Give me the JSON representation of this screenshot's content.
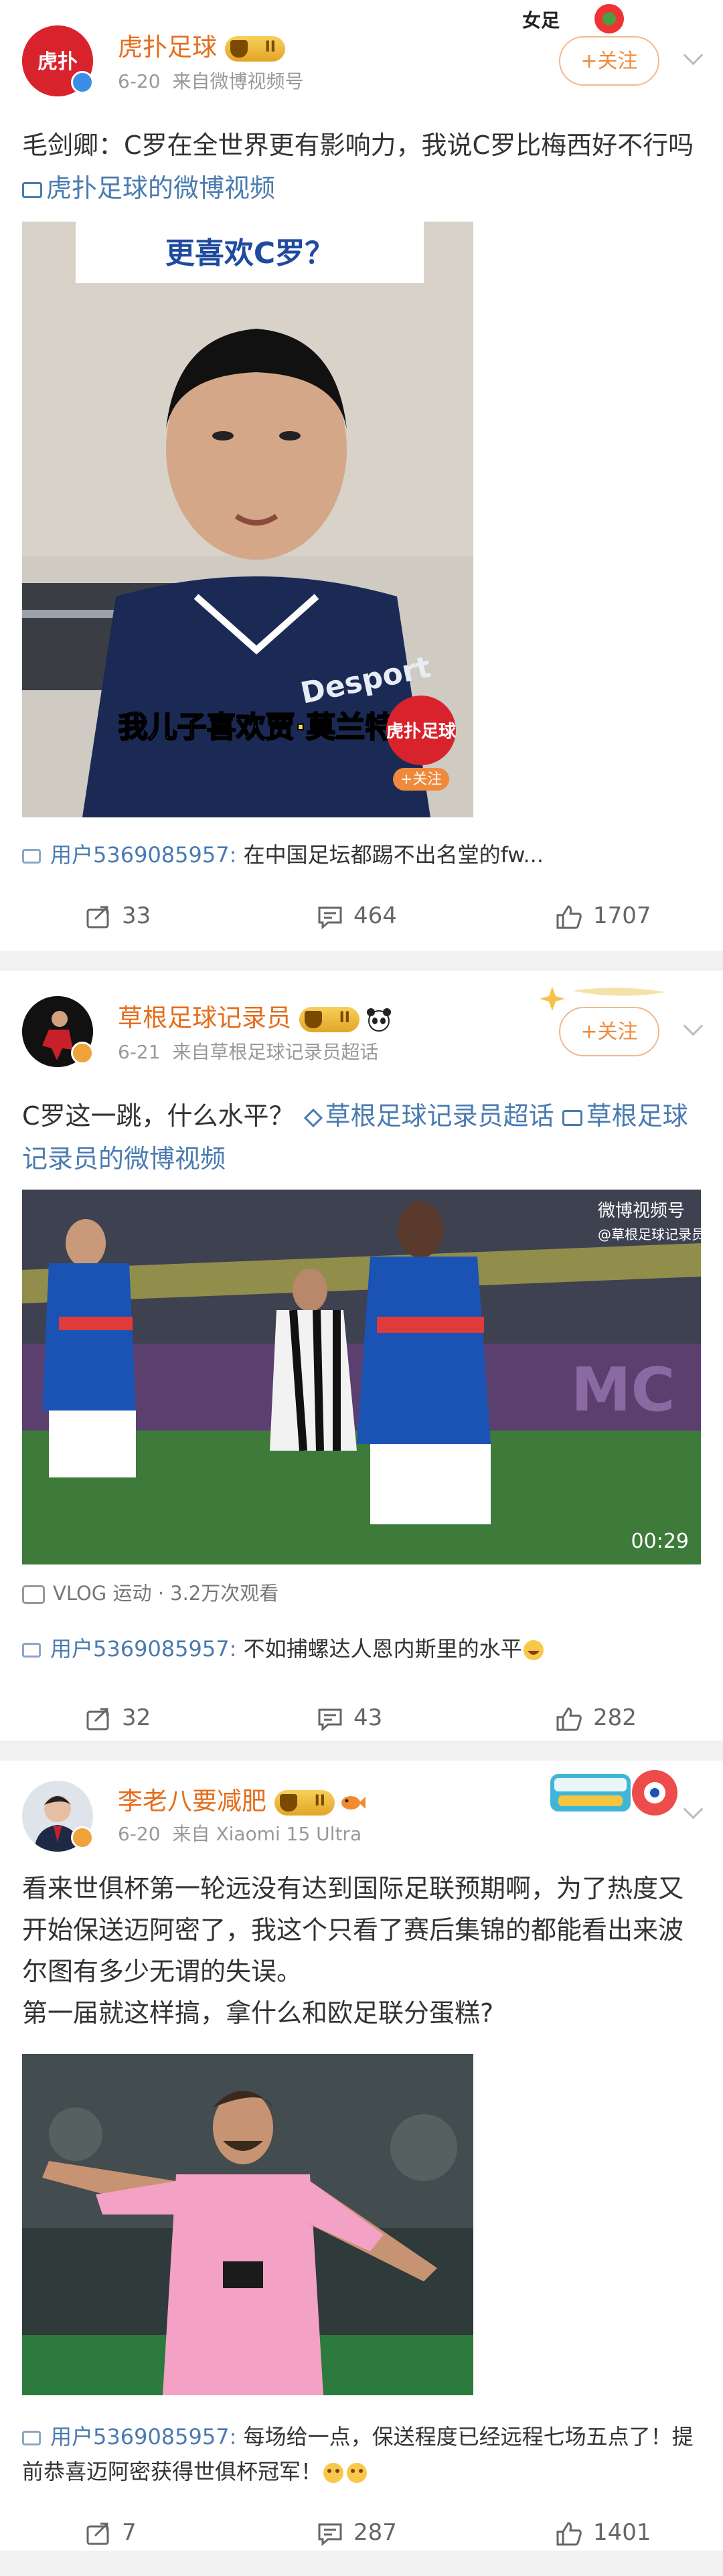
{
  "posts": [
    {
      "author": "虎扑足球",
      "level": "II",
      "date": "6-20",
      "source": "来自微博视频号",
      "follow": "+关注",
      "text_main": "毛剑卿：C罗在全世界更有影响力，我说C罗比梅西好不行吗",
      "text_link": "虎扑足球的微博视频",
      "video_caption_top": "更喜欢C罗？",
      "video_caption_bottom": "我儿子喜欢贾·莫兰特",
      "video_brand": "虎扑足球",
      "video_follow": "+关注",
      "comment_user": "用户5369085957:",
      "comment_text": " 在中国足坛都踢不出名堂的fw...",
      "reposts": "33",
      "comments": "464",
      "likes": "1707",
      "decor_label": "女足"
    },
    {
      "author": "草根足球记录员",
      "level": "II",
      "date": "6-21",
      "source": "来自草根足球记录员超话",
      "follow": "+关注",
      "text_main": "C罗这一跳，什么水平？",
      "text_link1": "草根足球记录员超话",
      "text_link2": "草根足球记录员的微博视频",
      "watermark": "微博视频号",
      "watermark_sub": "@草根足球记录员",
      "duration": "00:29",
      "vlog_info": "VLOG 运动 · 3.2万次观看",
      "comment_user": "用户5369085957:",
      "comment_text": " 不如捕螺达人恩内斯里的水平",
      "reposts": "32",
      "comments": "43",
      "likes": "282"
    },
    {
      "author": "李老八要减肥",
      "level": "II",
      "date": "6-20",
      "source": "来自 Xiaomi 15 Ultra",
      "text_main": "看来世俱杯第一轮远没有达到国际足联预期啊，为了热度又开始保送迈阿密了，我这个只看了赛后集锦的都能看出来波尔图有多少无谓的失误。",
      "text_line2": "第一届就这样搞，拿什么和欧足联分蛋糕?",
      "comment_user": "用户5369085957:",
      "comment_text": " 每场给一点，保送程度已经远程七场五点了！提前恭喜迈阿密获得世俱杯冠军！",
      "reposts": "7",
      "comments": "287",
      "likes": "1401"
    }
  ],
  "colors": {
    "name": "#e56d1b",
    "link": "#4a7bb0",
    "follow": "#ef8a3c"
  }
}
